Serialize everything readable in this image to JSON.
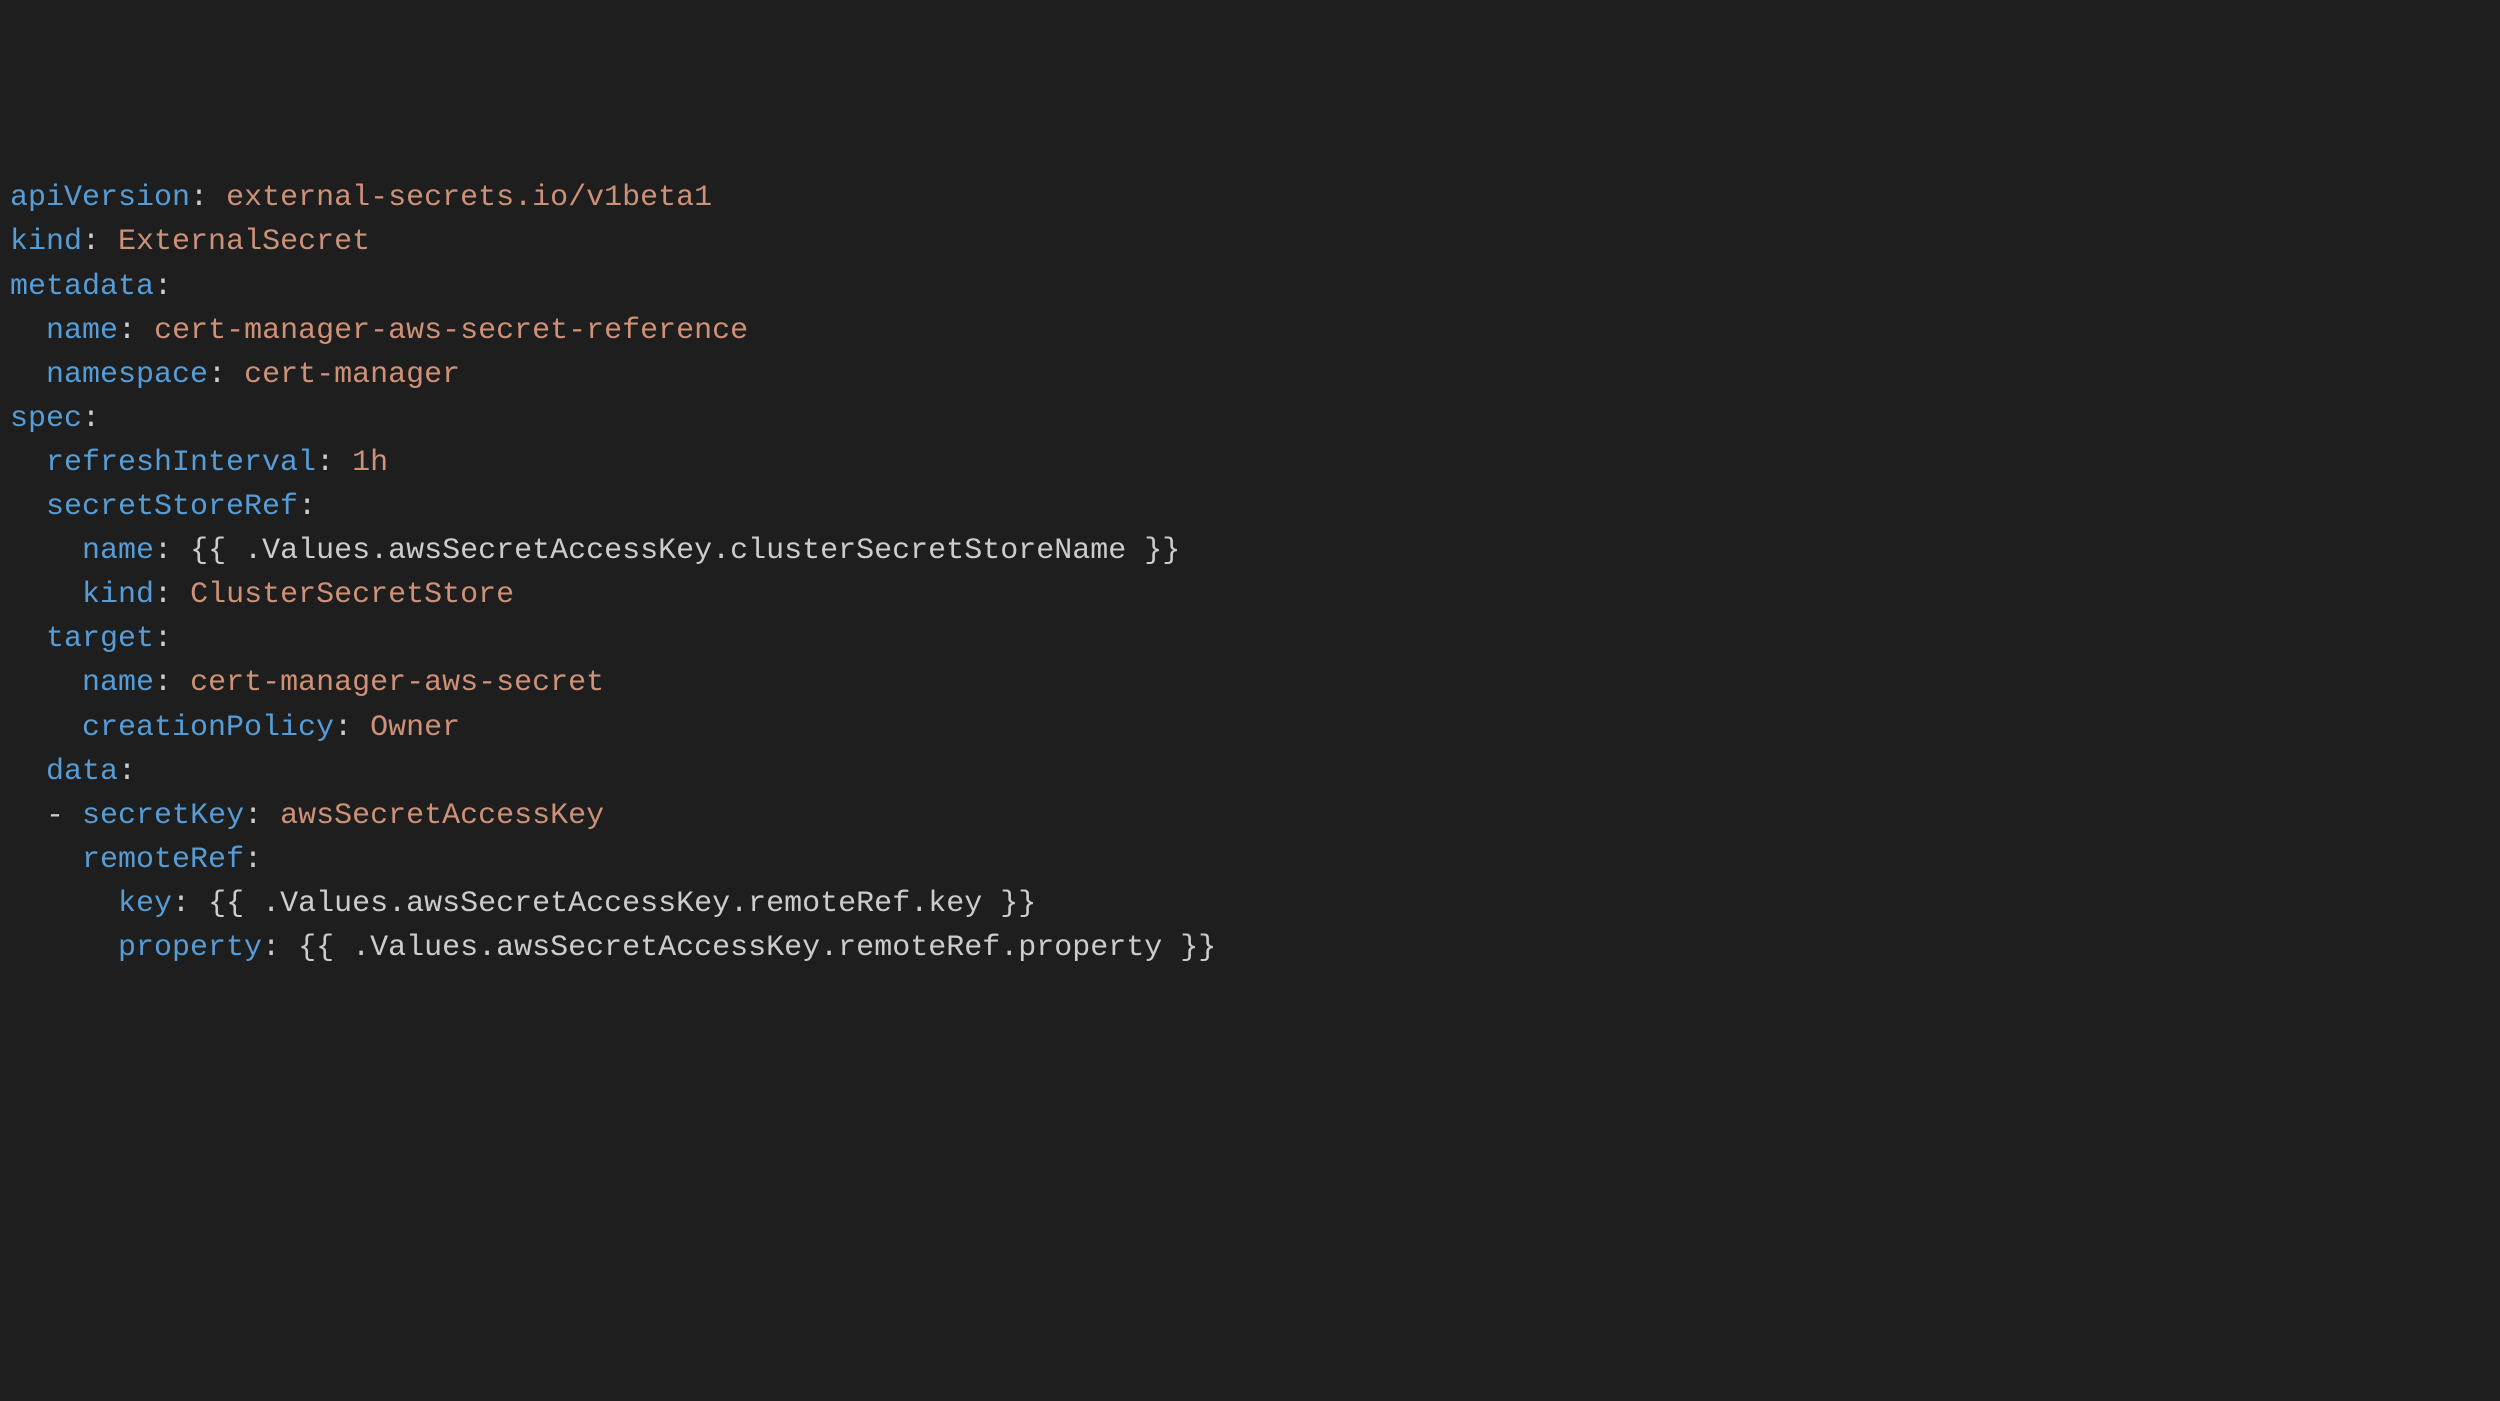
{
  "yaml": {
    "apiVersion": {
      "key": "apiVersion",
      "value": "external-secrets.io/v1beta1"
    },
    "kind": {
      "key": "kind",
      "value": "ExternalSecret"
    },
    "metadata": {
      "label": "metadata",
      "name": {
        "key": "name",
        "value": "cert-manager-aws-secret-reference"
      },
      "namespace": {
        "key": "namespace",
        "value": "cert-manager"
      }
    },
    "spec": {
      "label": "spec",
      "refreshInterval": {
        "key": "refreshInterval",
        "value": "1h"
      },
      "secretStoreRef": {
        "label": "secretStoreRef",
        "name": {
          "key": "name",
          "value": "{{ .Values.awsSecretAccessKey.clusterSecretStoreName }}"
        },
        "kind": {
          "key": "kind",
          "value": "ClusterSecretStore"
        }
      },
      "target": {
        "label": "target",
        "name": {
          "key": "name",
          "value": "cert-manager-aws-secret"
        },
        "creationPolicy": {
          "key": "creationPolicy",
          "value": "Owner"
        }
      },
      "data": {
        "label": "data",
        "dash": "-",
        "secretKey": {
          "key": "secretKey",
          "value": "awsSecretAccessKey"
        },
        "remoteRef": {
          "label": "remoteRef",
          "key": {
            "key": "key",
            "value": "{{ .Values.awsSecretAccessKey.remoteRef.key }}"
          },
          "property": {
            "key": "property",
            "value": "{{ .Values.awsSecretAccessKey.remoteRef.property }}"
          }
        }
      }
    }
  }
}
